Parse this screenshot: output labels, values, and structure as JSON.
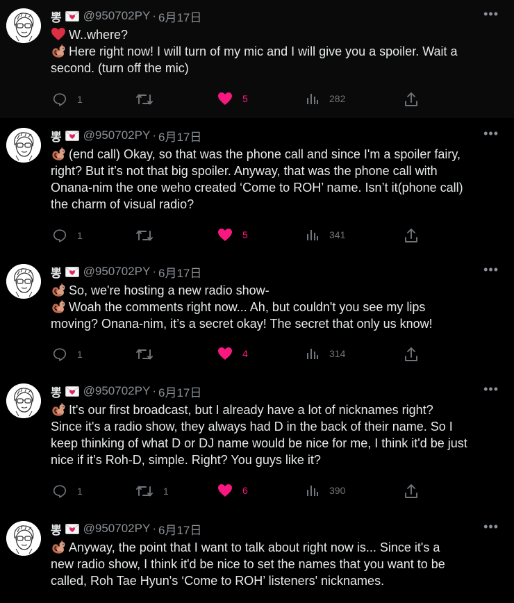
{
  "colors": {
    "background": "#000000",
    "text": "#e7e9ea",
    "muted": "#8b9196",
    "like": "#f91880"
  },
  "icons": [
    "avatar",
    "envelope-heart-icon",
    "more-icon",
    "heart-icon",
    "squirrel-icon",
    "reply-icon",
    "retweet-icon",
    "like-icon",
    "views-icon",
    "share-icon"
  ],
  "tweets": [
    {
      "name": "뽕",
      "handle": "@950702PY",
      "dot": "·",
      "date": "6月17日",
      "more": "•••",
      "lines": [
        {
          "icon": "heart",
          "text": "W..where?"
        },
        {
          "icon": "squirrel",
          "text": "Here right now! I will turn of my mic and I will give you a spoiler. Wait a"
        },
        {
          "icon": "",
          "text": "second. (turn off the mic)"
        }
      ],
      "reply_count": "1",
      "retweet_count": "",
      "like_count": "5",
      "view_count": "282"
    },
    {
      "name": "뽕",
      "handle": "@950702PY",
      "dot": "·",
      "date": "6月17日",
      "more": "•••",
      "lines": [
        {
          "icon": "squirrel",
          "text": "(end call) Okay, so that was the phone call and since I'm a spoiler fairy,"
        },
        {
          "icon": "",
          "text": "right? But it’s not that big spoiler. Anyway, that was the phone call with"
        },
        {
          "icon": "",
          "text": "Onana-nim the one weho created ‘Come to ROH’ name. Isn’t it(phone call)"
        },
        {
          "icon": "",
          "text": "the charm of visual radio?"
        }
      ],
      "reply_count": "1",
      "retweet_count": "",
      "like_count": "5",
      "view_count": "341"
    },
    {
      "name": "뽕",
      "handle": "@950702PY",
      "dot": "·",
      "date": "6月17日",
      "more": "•••",
      "lines": [
        {
          "icon": "squirrel",
          "text": "So, we're hosting a new radio show-"
        },
        {
          "icon": "squirrel",
          "text": "Woah the comments right now... Ah, but couldn't you see my lips"
        },
        {
          "icon": "",
          "text": "moving? Onana-nim, it’s a secret okay! The secret that only us know!"
        }
      ],
      "reply_count": "1",
      "retweet_count": "",
      "like_count": "4",
      "view_count": "314"
    },
    {
      "name": "뽕",
      "handle": "@950702PY",
      "dot": "·",
      "date": "6月17日",
      "more": "•••",
      "lines": [
        {
          "icon": "squirrel",
          "text": "It's our first broadcast, but I already have a lot of nicknames right?"
        },
        {
          "icon": "",
          "text": "Since it's a radio show, they always had D in the back of their name. So I"
        },
        {
          "icon": "",
          "text": "keep thinking of what D or DJ name would be nice for me, I think it'd be just"
        },
        {
          "icon": "",
          "text": "nice if it’s Roh-D, simple. Right? You guys like it?"
        }
      ],
      "reply_count": "1",
      "retweet_count": "1",
      "like_count": "6",
      "view_count": "390"
    },
    {
      "name": "뽕",
      "handle": "@950702PY",
      "dot": "·",
      "date": "6月17日",
      "more": "•••",
      "lines": [
        {
          "icon": "squirrel",
          "text": "Anyway, the point that I want to talk about right now is... Since it's a"
        },
        {
          "icon": "",
          "text": "new radio show, I think it'd be nice to set the names that you want to be"
        },
        {
          "icon": "",
          "text": "called, Roh Tae Hyun's ‘Come to ROH’ listeners' nicknames."
        }
      ],
      "reply_count": "",
      "retweet_count": "",
      "like_count": "",
      "view_count": ""
    }
  ]
}
